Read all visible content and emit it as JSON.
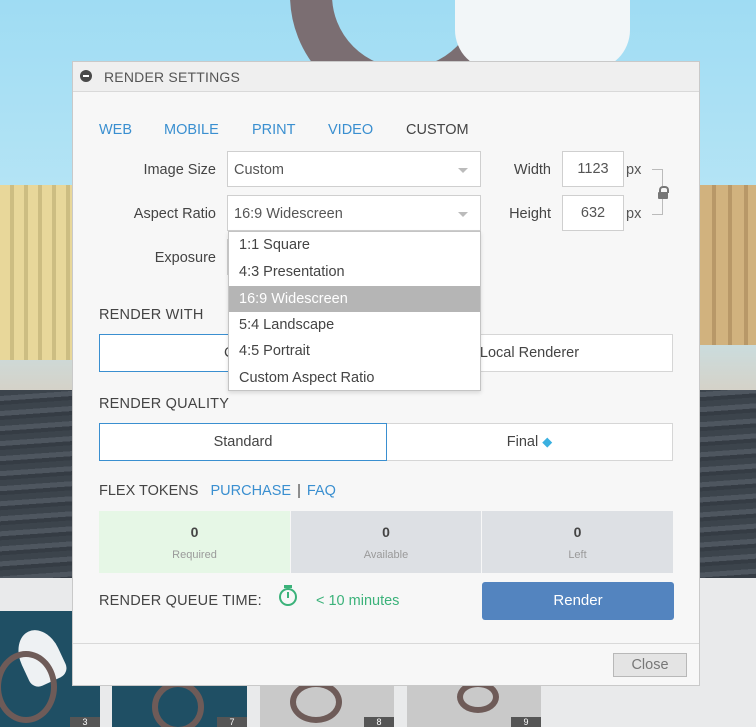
{
  "dialog": {
    "title": "RENDER SETTINGS",
    "tabs": [
      {
        "label": "WEB"
      },
      {
        "label": "MOBILE"
      },
      {
        "label": "PRINT"
      },
      {
        "label": "VIDEO"
      },
      {
        "label": "CUSTOM"
      }
    ],
    "active_tab": "CUSTOM",
    "image_size": {
      "label": "Image Size",
      "value": "Custom"
    },
    "aspect_ratio": {
      "label": "Aspect Ratio",
      "value": "16:9 Widescreen",
      "options": [
        "1:1 Square",
        "4:3 Presentation",
        "16:9 Widescreen",
        "5:4 Landscape",
        "4:5 Portrait",
        "Custom Aspect Ratio"
      ],
      "highlighted": "16:9 Widescreen"
    },
    "exposure": {
      "label": "Exposure"
    },
    "width": {
      "label": "Width",
      "value": "1123",
      "unit": "px"
    },
    "height": {
      "label": "Height",
      "value": "632",
      "unit": "px"
    },
    "render_with": {
      "heading": "RENDER WITH",
      "options": [
        "Cloud",
        "Local Renderer"
      ]
    },
    "render_quality": {
      "heading": "RENDER QUALITY",
      "options": [
        "Standard",
        "Final"
      ],
      "selected": "Standard"
    },
    "flex_tokens": {
      "heading": "FLEX TOKENS",
      "purchase_link": "PURCHASE",
      "separator": "|",
      "faq_link": "FAQ",
      "items": [
        {
          "value": "0",
          "caption": "Required"
        },
        {
          "value": "0",
          "caption": "Available"
        },
        {
          "value": "0",
          "caption": "Left"
        }
      ]
    },
    "queue": {
      "label": "RENDER QUEUE TIME:",
      "time": "< 10 minutes"
    },
    "render_button": "Render",
    "close_button": "Close"
  },
  "thumbnails": [
    {
      "badge": "3"
    },
    {
      "badge": "7"
    },
    {
      "badge": "8"
    },
    {
      "badge": "9"
    }
  ],
  "colors": {
    "accent": "#3a8fd0",
    "render_button": "#5384bf",
    "success": "#3bb27a",
    "required_tile": "#e6f7e6",
    "neutral_tile": "#dde0e4"
  },
  "icons": [
    "minus-circle-icon",
    "chevron-down-icon",
    "lock-icon",
    "diamond-icon",
    "clock-icon"
  ]
}
